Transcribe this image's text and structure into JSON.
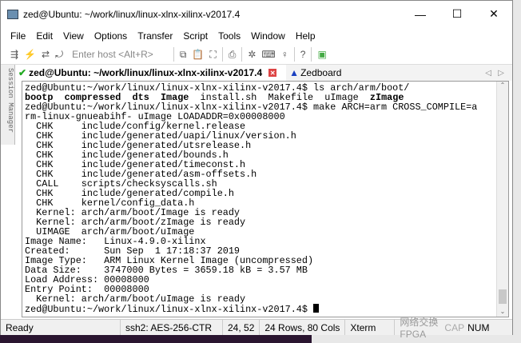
{
  "window": {
    "title": "zed@Ubuntu: ~/work/linux/linux-xlnx-xilinx-v2017.4",
    "minimize": "—",
    "maximize": "☐",
    "close": "✕"
  },
  "menu": [
    "File",
    "Edit",
    "View",
    "Options",
    "Transfer",
    "Script",
    "Tools",
    "Window",
    "Help"
  ],
  "toolbar": {
    "host_placeholder": "Enter host <Alt+R>"
  },
  "tabs": [
    {
      "label": "zed@Ubuntu: ~/work/linux/linux-xlnx-xilinx-v2017.4",
      "status": "connected"
    },
    {
      "label": "Zedboard",
      "status": "warning"
    }
  ],
  "sidebar": {
    "label": "Session Manager"
  },
  "terminal": {
    "lines": [
      "zed@Ubuntu:~/work/linux/linux-xlnx-xilinx-v2017.4$ ls arch/arm/boot/",
      "bootp  compressed  dts  Image  install.sh  Makefile  uImage  zImage",
      "zed@Ubuntu:~/work/linux/linux-xlnx-xilinx-v2017.4$ make ARCH=arm CROSS_COMPILE=a",
      "rm-linux-gnueabihf- uImage LOADADDR=0x00008000",
      "  CHK     include/config/kernel.release",
      "  CHK     include/generated/uapi/linux/version.h",
      "  CHK     include/generated/utsrelease.h",
      "  CHK     include/generated/bounds.h",
      "  CHK     include/generated/timeconst.h",
      "  CHK     include/generated/asm-offsets.h",
      "  CALL    scripts/checksyscalls.sh",
      "  CHK     include/generated/compile.h",
      "  CHK     kernel/config_data.h",
      "  Kernel: arch/arm/boot/Image is ready",
      "  Kernel: arch/arm/boot/zImage is ready",
      "  UIMAGE  arch/arm/boot/uImage",
      "Image Name:   Linux-4.9.0-xilinx",
      "Created:      Sun Sep  1 17:18:37 2019",
      "Image Type:   ARM Linux Kernel Image (uncompressed)",
      "Data Size:    3747000 Bytes = 3659.18 kB = 3.57 MB",
      "Load Address: 00008000",
      "Entry Point:  00008000",
      "  Kernel: arch/arm/boot/uImage is ready",
      "zed@Ubuntu:~/work/linux/linux-xlnx-xilinx-v2017.4$ "
    ]
  },
  "status": {
    "state": "Ready",
    "cipher": "ssh2: AES-256-CTR",
    "cursor": "24, 52",
    "size": "24 Rows, 80 Cols",
    "emulation": "Xterm",
    "caps": "CAP",
    "num": "NUM"
  },
  "watermark": "网络交换FPGA"
}
